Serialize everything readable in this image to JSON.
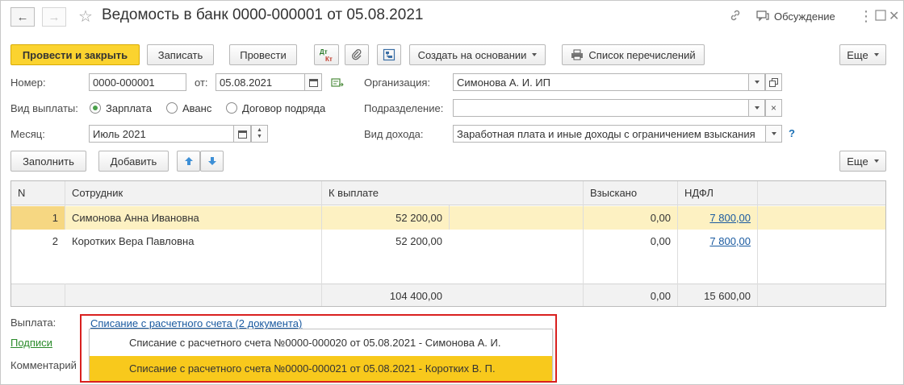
{
  "window": {
    "title": "Ведомость в банк 0000-000001 от 05.08.2021",
    "discussion_label": "Обсуждение"
  },
  "toolbar": {
    "post_and_close": "Провести и закрыть",
    "save": "Записать",
    "post": "Провести",
    "dt_kt_top": "Дт",
    "dt_kt_bottom": "Кт",
    "create_based_on": "Создать на основании",
    "transfer_list": "Список перечислений",
    "more": "Еще"
  },
  "header": {
    "number_label": "Номер:",
    "number_value": "0000-000001",
    "date_label": "от:",
    "date_value": "05.08.2021",
    "org_label": "Организация:",
    "org_value": "Симонова А. И. ИП",
    "payment_type_label": "Вид выплаты:",
    "payment_types": [
      "Зарплата",
      "Аванс",
      "Договор подряда"
    ],
    "payment_type_selected": "Зарплата",
    "department_label": "Подразделение:",
    "department_value": "",
    "month_label": "Месяц:",
    "month_value": "Июль 2021",
    "income_type_label": "Вид дохода:",
    "income_type_value": "Заработная плата и иные доходы с ограничением взыскания",
    "help_mark": "?"
  },
  "table_toolbar": {
    "fill": "Заполнить",
    "add": "Добавить",
    "more": "Еще"
  },
  "table": {
    "columns": [
      "N",
      "Сотрудник",
      "К выплате",
      "Взыскано",
      "НДФЛ"
    ],
    "rows": [
      {
        "n": "1",
        "employee": "Симонова Анна Ивановна",
        "to_pay": "52 200,00",
        "recovered": "0,00",
        "ndfl": "7 800,00",
        "selected": true
      },
      {
        "n": "2",
        "employee": "Коротких Вера Павловна",
        "to_pay": "52 200,00",
        "recovered": "0,00",
        "ndfl": "7 800,00",
        "selected": false
      }
    ],
    "totals": {
      "to_pay": "104 400,00",
      "recovered": "0,00",
      "ndfl": "15 600,00"
    }
  },
  "footer": {
    "payment_label": "Выплата:",
    "payment_link": "Списание с расчетного счета (2 документа)",
    "signatures_link": "Подписи",
    "comment_label": "Комментарий",
    "popup_items": [
      "Списание с расчетного счета №0000-000020 от 05.08.2021 - Симонова А. И.",
      "Списание с расчетного счета №0000-000021 от 05.08.2021 - Коротких В. П."
    ]
  },
  "colors": {
    "primary_button": "#fbd32f",
    "selected_row": "#fdf1c2",
    "link": "#1a5aa0",
    "highlight_frame": "#d9201f",
    "popup_selected": "#f8c91c"
  }
}
